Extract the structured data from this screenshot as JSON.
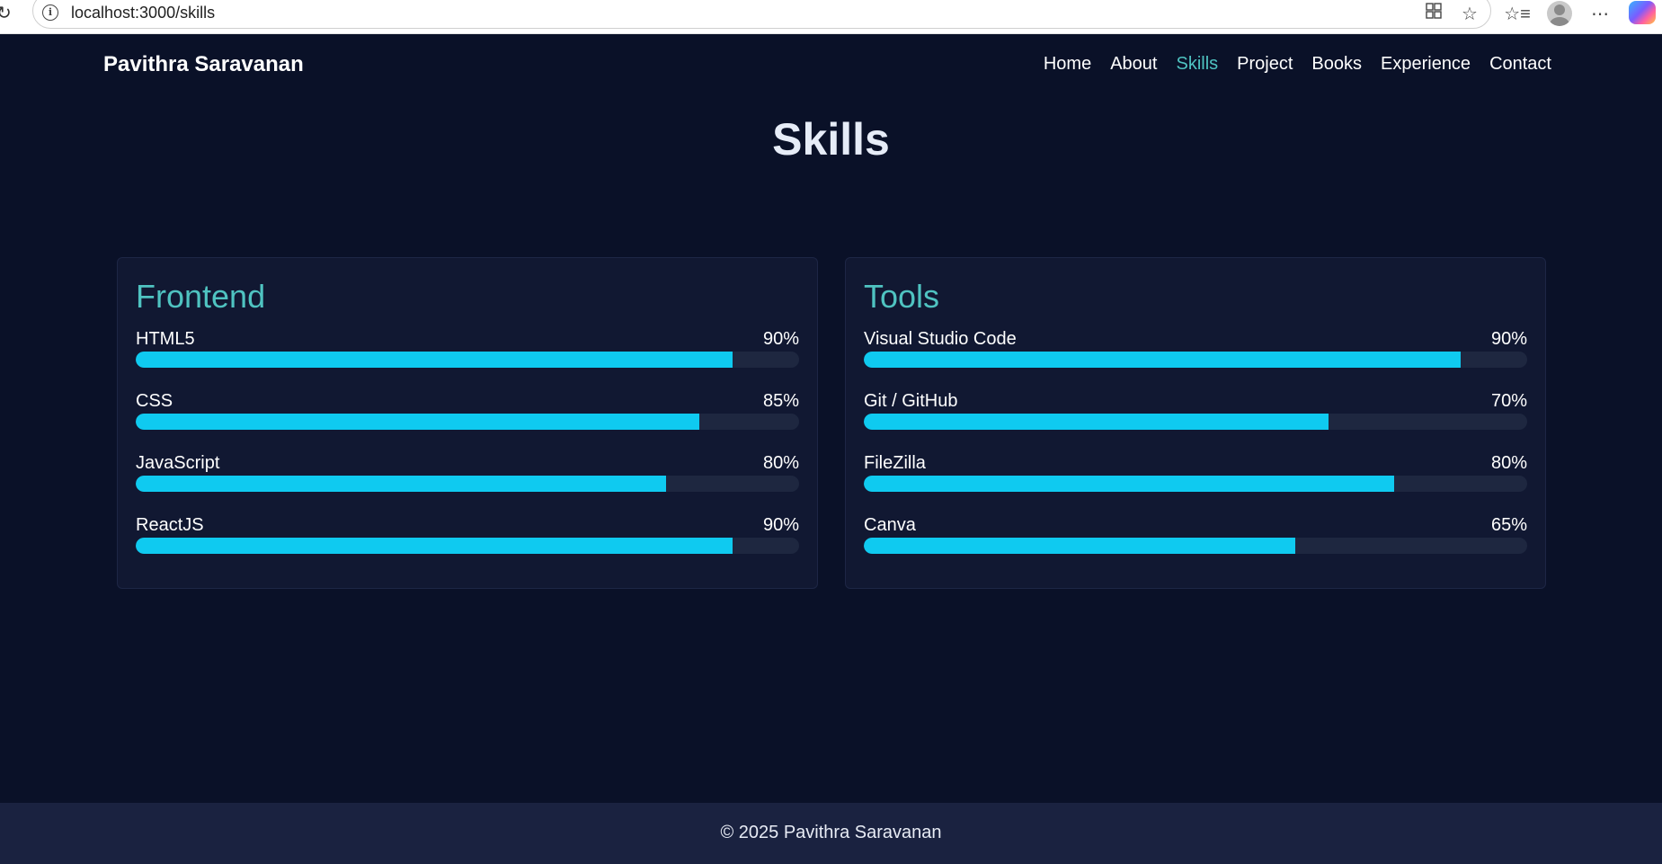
{
  "browser": {
    "url": "localhost:3000/skills",
    "icons": [
      "reload-icon",
      "info-icon",
      "app-grid-icon",
      "favorite-star-icon",
      "favorites-list-icon",
      "profile-avatar-icon",
      "more-icon",
      "copilot-icon"
    ]
  },
  "site": {
    "brand": "Pavithra Saravanan",
    "nav": [
      {
        "label": "Home",
        "active": false
      },
      {
        "label": "About",
        "active": false
      },
      {
        "label": "Skills",
        "active": true
      },
      {
        "label": "Project",
        "active": false
      },
      {
        "label": "Books",
        "active": false
      },
      {
        "label": "Experience",
        "active": false
      },
      {
        "label": "Contact",
        "active": false
      }
    ],
    "title": "Skills",
    "colors": {
      "accent": "#4fc3c1",
      "bar": "#0fcaf0",
      "background": "#0a1128"
    }
  },
  "cards": [
    {
      "title": "Frontend",
      "skills": [
        {
          "name": "HTML5",
          "percent_label": "90%",
          "value": 0.9
        },
        {
          "name": "CSS",
          "percent_label": "85%",
          "value": 0.85
        },
        {
          "name": "JavaScript",
          "percent_label": "80%",
          "value": 0.8
        },
        {
          "name": "ReactJS",
          "percent_label": "90%",
          "value": 0.9
        }
      ]
    },
    {
      "title": "Tools",
      "skills": [
        {
          "name": "Visual Studio Code",
          "percent_label": "90%",
          "value": 0.9
        },
        {
          "name": "Git / GitHub",
          "percent_label": "70%",
          "value": 0.7
        },
        {
          "name": "FileZilla",
          "percent_label": "80%",
          "value": 0.8
        },
        {
          "name": "Canva",
          "percent_label": "65%",
          "value": 0.65
        }
      ]
    }
  ],
  "footer": {
    "text": "© 2025 Pavithra Saravanan"
  }
}
